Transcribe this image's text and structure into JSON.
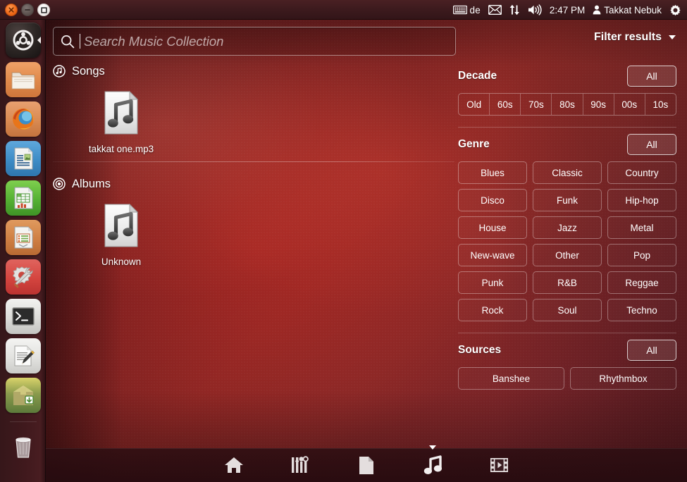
{
  "panel": {
    "window_buttons": [
      {
        "name": "close",
        "glyph": "×"
      },
      {
        "name": "minimize",
        "glyph": "–"
      },
      {
        "name": "maximize",
        "glyph": "□"
      }
    ],
    "keyboard_layout": "de",
    "clock": "2:47 PM",
    "user": "Takkat Nebuk",
    "indicators": [
      "keyboard-icon",
      "mail-icon",
      "network-icon",
      "volume-icon",
      "session-icon",
      "system-settings-icon"
    ]
  },
  "launcher": {
    "items": [
      {
        "name": "ubuntu-dash-button",
        "label": "Ubuntu"
      },
      {
        "name": "files-nautilus",
        "label": "Files"
      },
      {
        "name": "firefox",
        "label": "Firefox Web Browser"
      },
      {
        "name": "libreoffice-writer",
        "label": "LibreOffice Writer"
      },
      {
        "name": "libreoffice-calc",
        "label": "LibreOffice Calc"
      },
      {
        "name": "libreoffice-impress",
        "label": "LibreOffice Impress"
      },
      {
        "name": "system-settings",
        "label": "System Settings"
      },
      {
        "name": "terminal",
        "label": "Terminal"
      },
      {
        "name": "text-editor",
        "label": "Text Editor"
      },
      {
        "name": "ubuntu-software-center",
        "label": "Ubuntu Software Center"
      },
      {
        "name": "trash",
        "label": "Trash"
      }
    ]
  },
  "search": {
    "placeholder": "Search Music Collection",
    "value": ""
  },
  "filter_header": {
    "label": "Filter results"
  },
  "results": {
    "groups": [
      {
        "icon": "music-note-circle-icon",
        "title": "Songs",
        "items": [
          {
            "label": "takkat one.mp3",
            "icon": "audio-file-icon"
          }
        ]
      },
      {
        "icon": "album-disc-icon",
        "title": "Albums",
        "items": [
          {
            "label": "Unknown",
            "icon": "audio-file-icon"
          }
        ]
      }
    ]
  },
  "filters": {
    "decade": {
      "title": "Decade",
      "all_label": "All",
      "options": [
        "Old",
        "60s",
        "70s",
        "80s",
        "90s",
        "00s",
        "10s"
      ]
    },
    "genre": {
      "title": "Genre",
      "all_label": "All",
      "options": [
        "Blues",
        "Classic",
        "Country",
        "Disco",
        "Funk",
        "Hip-hop",
        "House",
        "Jazz",
        "Metal",
        "New-wave",
        "Other",
        "Pop",
        "Punk",
        "R&B",
        "Reggae",
        "Rock",
        "Soul",
        "Techno"
      ]
    },
    "sources": {
      "title": "Sources",
      "all_label": "All",
      "options": [
        "Banshee",
        "Rhythmbox"
      ]
    }
  },
  "lensbar": {
    "lenses": [
      {
        "name": "home-lens",
        "label": "Home",
        "active": false
      },
      {
        "name": "applications-lens",
        "label": "Applications",
        "active": false
      },
      {
        "name": "files-lens",
        "label": "Files & Folders",
        "active": false
      },
      {
        "name": "music-lens",
        "label": "Music",
        "active": true
      },
      {
        "name": "video-lens",
        "label": "Videos",
        "active": false
      }
    ]
  },
  "colors": {
    "dash_base": "#8a2c2a",
    "panel": "#3c1a1d",
    "launcher": "#40191d",
    "accent_orange": "#ef6b1a",
    "text": "#ffffff"
  }
}
